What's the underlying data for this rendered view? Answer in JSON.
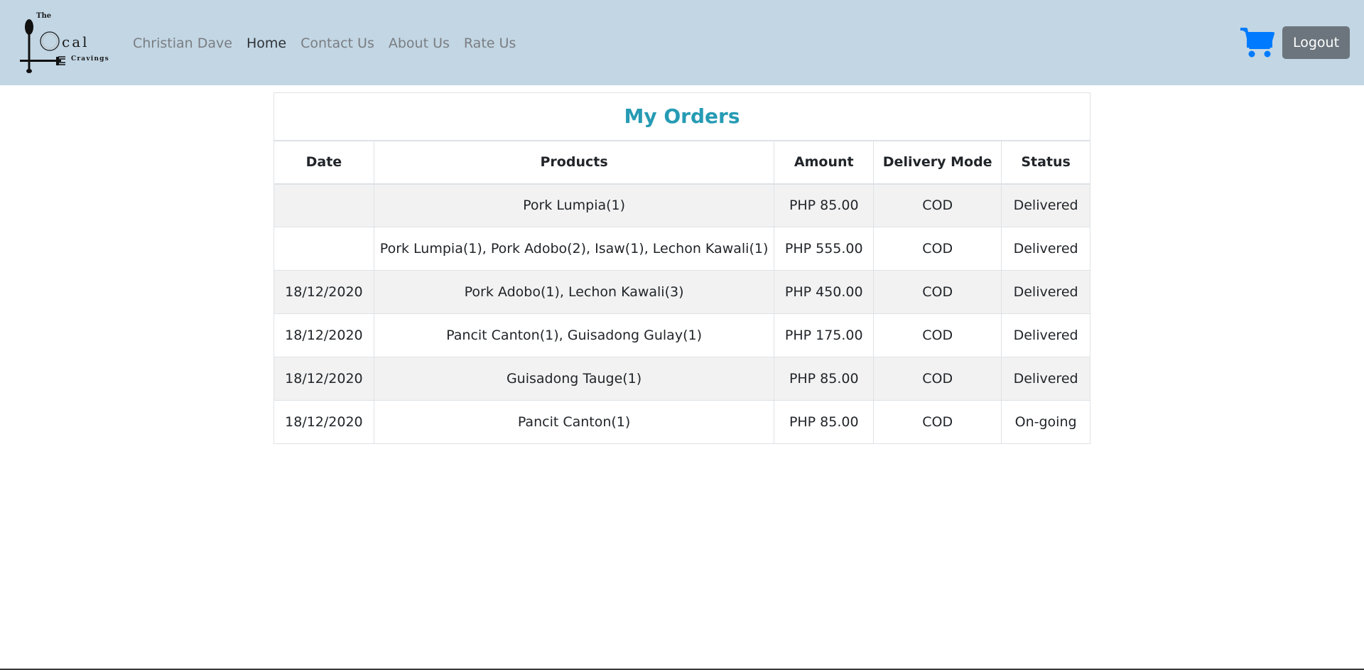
{
  "brand": {
    "logo_the": "The",
    "logo_ocal": "cal",
    "logo_cravings": "Cravings"
  },
  "nav": {
    "items": [
      {
        "label": "Christian Dave"
      },
      {
        "label": "Home"
      },
      {
        "label": "Contact Us"
      },
      {
        "label": "About Us"
      },
      {
        "label": "Rate Us"
      }
    ],
    "active": "Home",
    "cart_icon": "shopping-cart-icon",
    "cart_color": "#007bff",
    "logout_label": "Logout"
  },
  "orders": {
    "title": "My Orders",
    "title_color": "#269bb4",
    "columns": [
      "Date",
      "Products",
      "Amount",
      "Delivery Mode",
      "Status"
    ],
    "rows": [
      {
        "date": "",
        "products": "Pork Lumpia(1)",
        "amount": "PHP 85.00",
        "mode": "COD",
        "status": "Delivered"
      },
      {
        "date": "",
        "products": "Pork Lumpia(1), Pork Adobo(2), Isaw(1), Lechon Kawali(1)",
        "amount": "PHP 555.00",
        "mode": "COD",
        "status": "Delivered"
      },
      {
        "date": "18/12/2020",
        "products": "Pork Adobo(1), Lechon Kawali(3)",
        "amount": "PHP 450.00",
        "mode": "COD",
        "status": "Delivered"
      },
      {
        "date": "18/12/2020",
        "products": "Pancit Canton(1), Guisadong Gulay(1)",
        "amount": "PHP 175.00",
        "mode": "COD",
        "status": "Delivered"
      },
      {
        "date": "18/12/2020",
        "products": "Guisadong Tauge(1)",
        "amount": "PHP 85.00",
        "mode": "COD",
        "status": "Delivered"
      },
      {
        "date": "18/12/2020",
        "products": "Pancit Canton(1)",
        "amount": "PHP 85.00",
        "mode": "COD",
        "status": "On-going"
      }
    ]
  }
}
